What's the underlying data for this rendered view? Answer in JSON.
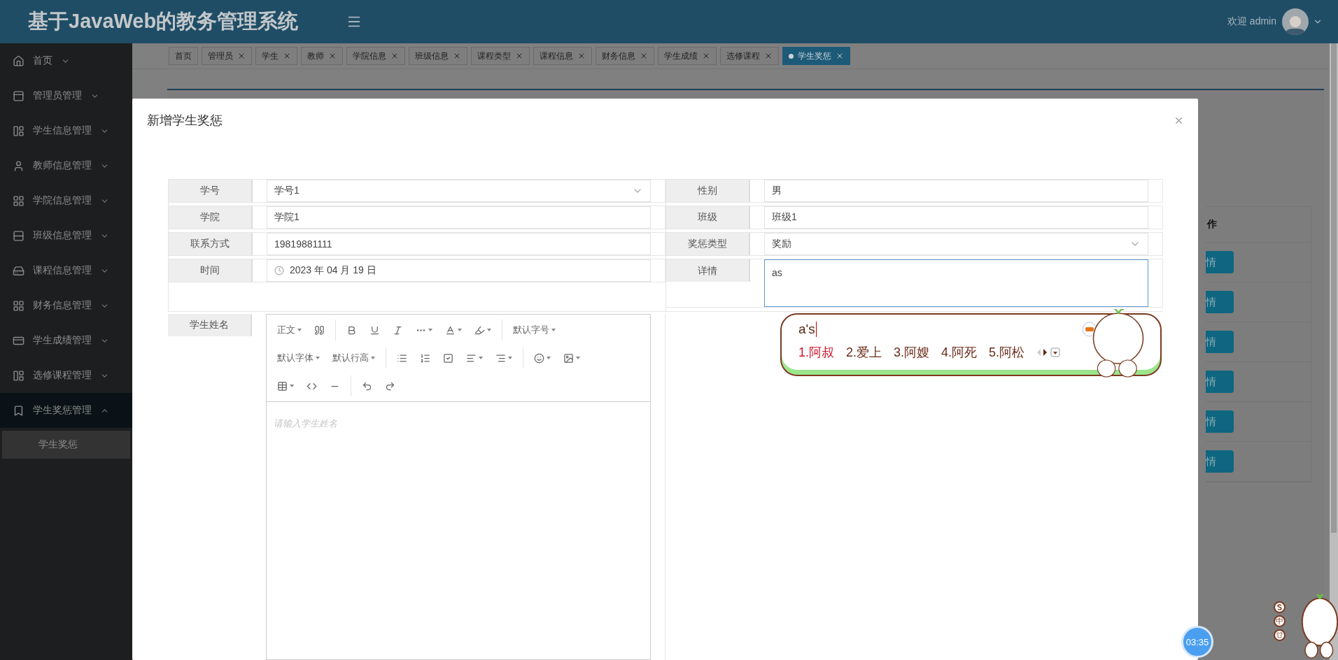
{
  "header": {
    "title": "基于JavaWeb的教务管理系统",
    "welcome": "欢迎 admin"
  },
  "sidebar": {
    "items": [
      {
        "label": "首页",
        "expanded": false
      },
      {
        "label": "管理员管理",
        "expanded": false
      },
      {
        "label": "学生信息管理",
        "expanded": false
      },
      {
        "label": "教师信息管理",
        "expanded": false
      },
      {
        "label": "学院信息管理",
        "expanded": false
      },
      {
        "label": "班级信息管理",
        "expanded": false
      },
      {
        "label": "课程信息管理",
        "expanded": false
      },
      {
        "label": "财务信息管理",
        "expanded": false
      },
      {
        "label": "学生成绩管理",
        "expanded": false
      },
      {
        "label": "选修课程管理",
        "expanded": false
      },
      {
        "label": "学生奖惩管理",
        "expanded": true,
        "children": [
          {
            "label": "学生奖惩",
            "selected": true
          }
        ]
      }
    ]
  },
  "tabs": [
    {
      "label": "首页",
      "closable": false,
      "selected": false
    },
    {
      "label": "管理员",
      "closable": true,
      "selected": false
    },
    {
      "label": "学生",
      "closable": true,
      "selected": false
    },
    {
      "label": "教师",
      "closable": true,
      "selected": false
    },
    {
      "label": "学院信息",
      "closable": true,
      "selected": false
    },
    {
      "label": "班级信息",
      "closable": true,
      "selected": false
    },
    {
      "label": "课程类型",
      "closable": true,
      "selected": false
    },
    {
      "label": "课程信息",
      "closable": true,
      "selected": false
    },
    {
      "label": "财务信息",
      "closable": true,
      "selected": false
    },
    {
      "label": "学生成绩",
      "closable": true,
      "selected": false
    },
    {
      "label": "选修课程",
      "closable": true,
      "selected": false
    },
    {
      "label": "学生奖惩",
      "closable": true,
      "selected": true
    }
  ],
  "background_table": {
    "column_1": "作",
    "buttons": [
      "情",
      "情",
      "情",
      "情",
      "情",
      "情"
    ]
  },
  "modal": {
    "title": "新增学生奖惩",
    "left_fields": [
      {
        "label": "学号",
        "kind": "select",
        "value": "学号1"
      },
      {
        "label": "学院",
        "kind": "text",
        "value": "学院1"
      },
      {
        "label": "联系方式",
        "kind": "text",
        "value": "19819881111"
      },
      {
        "label": "时间",
        "kind": "date",
        "value": "2023 年 04 月 19 日"
      }
    ],
    "right_fields": [
      {
        "label": "性别",
        "kind": "text",
        "value": "男"
      },
      {
        "label": "班级",
        "kind": "text",
        "value": "班级1"
      },
      {
        "label": "奖惩类型",
        "kind": "select",
        "value": "奖励"
      },
      {
        "label": "详情",
        "kind": "textarea",
        "value": "as",
        "focused": true
      }
    ],
    "editor": {
      "label": "学生姓名",
      "placeholder": "请输入学生姓名",
      "toolbar_labels": [
        "正文",
        "默认字号",
        "默认字体",
        "默认行高"
      ]
    }
  },
  "ime": {
    "composition": "a's",
    "candidates": [
      {
        "text": "1.阿叔",
        "selected": true
      },
      {
        "text": "2.爱上",
        "selected": false
      },
      {
        "text": "3.阿嫂",
        "selected": false
      },
      {
        "text": "4.阿死",
        "selected": false
      },
      {
        "text": "5.阿松",
        "selected": false
      }
    ]
  },
  "ime_status": {
    "mode": "中"
  },
  "timer": {
    "time": "03:35"
  }
}
